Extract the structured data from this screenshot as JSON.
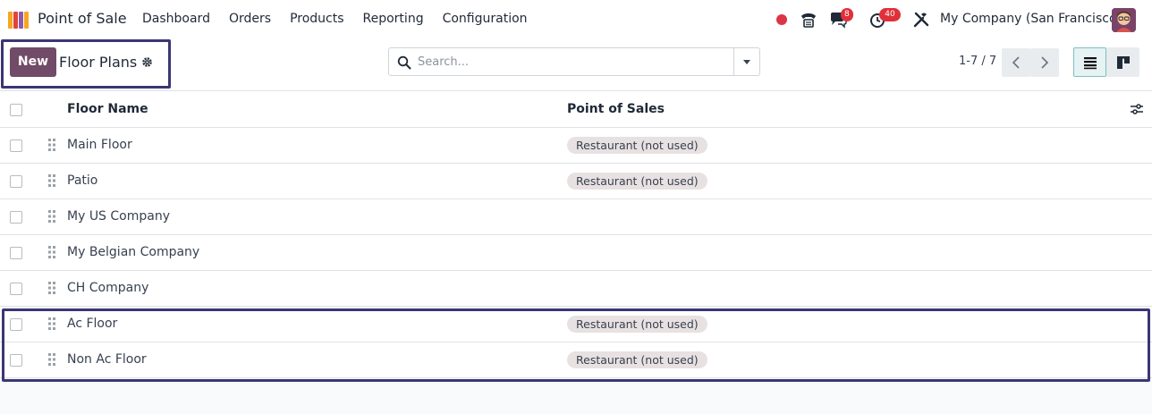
{
  "app": {
    "name": "Point of Sale"
  },
  "menu": [
    "Dashboard",
    "Orders",
    "Products",
    "Reporting",
    "Configuration"
  ],
  "systray": {
    "chat_badge": "8",
    "activity_badge": "40",
    "company": "My Company (San Francisco)",
    "record_color": "#dc3545"
  },
  "control": {
    "new_label": "New",
    "title": "Floor Plans",
    "search_placeholder": "Search...",
    "pager": "1-7 / 7"
  },
  "table": {
    "headers": {
      "name": "Floor Name",
      "pos": "Point of Sales"
    },
    "rows": [
      {
        "name": "Main Floor",
        "pos": "Restaurant (not used)"
      },
      {
        "name": "Patio",
        "pos": "Restaurant (not used)"
      },
      {
        "name": "My US Company",
        "pos": ""
      },
      {
        "name": "My Belgian Company",
        "pos": ""
      },
      {
        "name": "CH Company",
        "pos": ""
      },
      {
        "name": "Ac Floor",
        "pos": "Restaurant (not used)"
      },
      {
        "name": "Non Ac Floor",
        "pos": "Restaurant (not used)"
      }
    ]
  },
  "colors": {
    "brand": "#714b67",
    "highlight": "#3b3672",
    "tag_bg": "#e8e1e1"
  }
}
